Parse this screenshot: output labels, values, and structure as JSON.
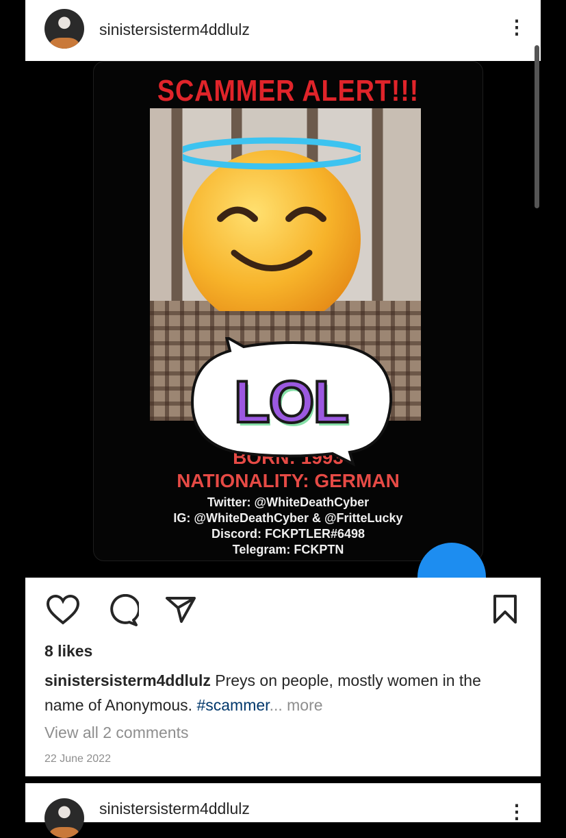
{
  "post": {
    "username": "sinistersisterm4ddlulz",
    "menu_icon": "kebab-icon",
    "poster": {
      "title": "SCAMMER ALERT!!!",
      "born": "BORN: 1993",
      "nationality": "NATIONALITY: GERMAN",
      "twitter": "Twitter: @WhiteDeathCyber",
      "ig": "IG: @WhiteDeathCyber & @FritteLucky",
      "discord": "Discord: FCKPTLER#6498",
      "telegram": "Telegram: FCKPTN",
      "sticker_text": "LOL"
    },
    "likes": "8 likes",
    "caption_user": "sinistersisterm4ddlulz",
    "caption_text": " Preys on people, mostly women in the name of Anonymous. ",
    "caption_hashtag": "#scammer",
    "caption_more": "... more",
    "view_comments": "View all 2 comments",
    "date": "22 June 2022"
  },
  "next_post": {
    "username": "sinistersisterm4ddlulz"
  },
  "colors": {
    "alert_red": "#e0242a",
    "hashtag_blue": "#00376b",
    "muted_gray": "#8e8e8e"
  }
}
